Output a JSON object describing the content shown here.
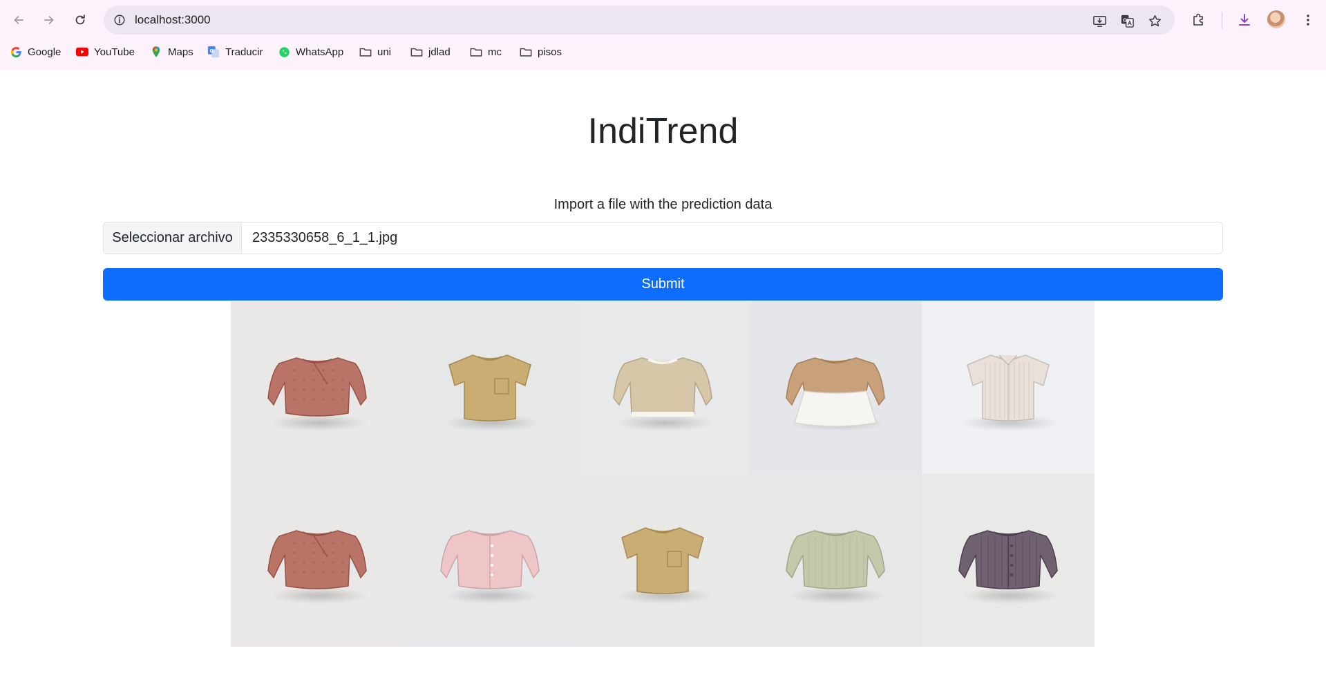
{
  "browser": {
    "url": "localhost:3000",
    "bookmarks": [
      {
        "label": "Google",
        "icon": "google-icon"
      },
      {
        "label": "YouTube",
        "icon": "youtube-icon"
      },
      {
        "label": "Maps",
        "icon": "maps-icon"
      },
      {
        "label": "Traducir",
        "icon": "translate-icon"
      },
      {
        "label": "WhatsApp",
        "icon": "whatsapp-icon"
      },
      {
        "label": "uni",
        "icon": "folder-icon"
      },
      {
        "label": "jdlad",
        "icon": "folder-icon"
      },
      {
        "label": "mc",
        "icon": "folder-icon"
      },
      {
        "label": "pisos",
        "icon": "folder-icon"
      }
    ],
    "colors": {
      "chrome_bg": "#fbf2fb",
      "omnibox_bg": "#ede5ef",
      "download_accent": "#8a3fd1"
    }
  },
  "page": {
    "title": "IndiTrend",
    "import_label": "Import a file with the prediction data",
    "file_button_label": "Seleccionar archivo",
    "file_name": "2335330658_6_1_1.jpg",
    "submit_label": "Submit",
    "colors": {
      "submit_bg": "#0d6efd",
      "submit_text": "#ffffff"
    }
  },
  "gallery": {
    "items": [
      {
        "garment": "quilted-sweater",
        "color": "#b97467",
        "bg": "#e9e8e6"
      },
      {
        "garment": "pocket-tshirt",
        "color": "#c9ad73",
        "bg": "#e6e7e7"
      },
      {
        "garment": "layered-sweatshirt",
        "color": "#d6c7a8",
        "bg": "#e8e9ea"
      },
      {
        "garment": "peplum-sweatshirt",
        "color": "#c8a17a",
        "bg": "#e4e6e9"
      },
      {
        "garment": "striped-shirt",
        "color": "#e9e1d9",
        "bg": "#eff0f3"
      },
      {
        "garment": "quilted-sweater",
        "color": "#b97467",
        "bg": "#e9e8e6"
      },
      {
        "garment": "pink-cardigan",
        "color": "#efc6c7",
        "bg": "#e6e8ea"
      },
      {
        "garment": "pocket-tshirt",
        "color": "#c9ad73",
        "bg": "#e8e8e7"
      },
      {
        "garment": "sage-sweater",
        "color": "#c3c9ab",
        "bg": "#e6e8e8"
      },
      {
        "garment": "plum-cardigan",
        "color": "#6f6170",
        "bg": "#e9e9e7"
      }
    ]
  }
}
